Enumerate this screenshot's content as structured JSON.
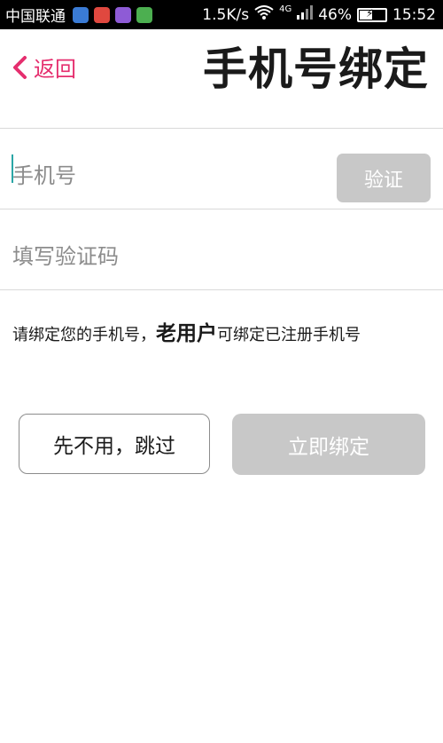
{
  "statusbar": {
    "carrier": "中国联通",
    "app_icons": [
      {
        "name": "sync-app-icon",
        "color": "#3a7bd5"
      },
      {
        "name": "heart-app-icon",
        "color": "#e0483f"
      },
      {
        "name": "gallery-app-icon",
        "color": "#8e5bd6"
      },
      {
        "name": "message-app-icon",
        "color": "#4caf50"
      }
    ],
    "speed": "1.5K/s",
    "network": "4G",
    "battery": "46%",
    "time": "15:52"
  },
  "header": {
    "back_label": "返回",
    "title": "手机号绑定",
    "accent_color": "#e52e6e"
  },
  "phone_field": {
    "placeholder": "手机号",
    "verify_label": "验证"
  },
  "code_field": {
    "placeholder": "填写验证码"
  },
  "hint": {
    "part1": "请绑定您的手机号，",
    "emphasis": "老用户",
    "part2": "可绑定已注册手机号"
  },
  "actions": {
    "skip_label": "先不用，跳过",
    "bind_label": "立即绑定"
  }
}
